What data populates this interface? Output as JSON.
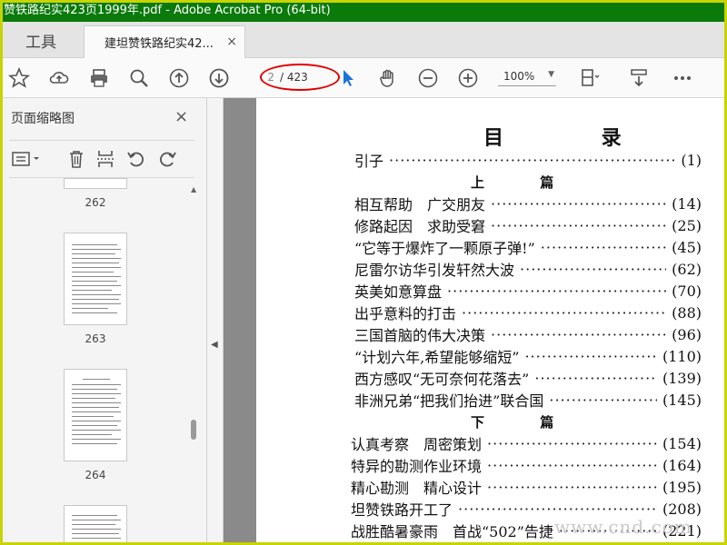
{
  "window": {
    "title": "赞铁路纪实423页1999年.pdf - Adobe Acrobat Pro (64-bit)"
  },
  "tabs": {
    "tools": "工具",
    "document": "建坦赞铁路纪实42...",
    "close": "×"
  },
  "toolbar": {
    "page_current": "2",
    "page_total": "/ 423",
    "zoom": "100%"
  },
  "sidebar": {
    "title": "页面缩略图",
    "close": "×",
    "thumbnails": [
      {
        "label": "262"
      },
      {
        "label": "263"
      },
      {
        "label": "264"
      }
    ]
  },
  "toc": {
    "title": "目 录",
    "section_up": "上 篇",
    "section_down": "下 篇",
    "entries": [
      {
        "text": "引子",
        "page": "(1)"
      },
      {
        "text": "相互帮助　广交朋友",
        "page": "(14)"
      },
      {
        "text": "修路起因　求助受窘",
        "page": "(25)"
      },
      {
        "text": "“它等于爆炸了一颗原子弹!”",
        "page": "(45)"
      },
      {
        "text": "尼雷尔访华引发轩然大波",
        "page": "(62)"
      },
      {
        "text": "英美如意算盘",
        "page": "(70)"
      },
      {
        "text": "出乎意料的打击",
        "page": "(88)"
      },
      {
        "text": "三国首脑的伟大决策",
        "page": "(96)"
      },
      {
        "text": "“计划六年,希望能够缩短”",
        "page": "(110)"
      },
      {
        "text": "西方感叹“无可奈何花落去”",
        "page": "(139)"
      },
      {
        "text": "非洲兄弟“把我们抬进”联合国",
        "page": "(145)"
      },
      {
        "text": "认真考察　周密策划",
        "page": "(154)"
      },
      {
        "text": "特异的勘测作业环境",
        "page": "(164)"
      },
      {
        "text": "精心勘测　精心设计",
        "page": "(195)"
      },
      {
        "text": "坦赞铁路开工了",
        "page": "(208)"
      },
      {
        "text": "战胜酷暑豪雨　首战“502”告捷",
        "page": "(221)"
      }
    ]
  },
  "watermark": "www.cnd.com"
}
